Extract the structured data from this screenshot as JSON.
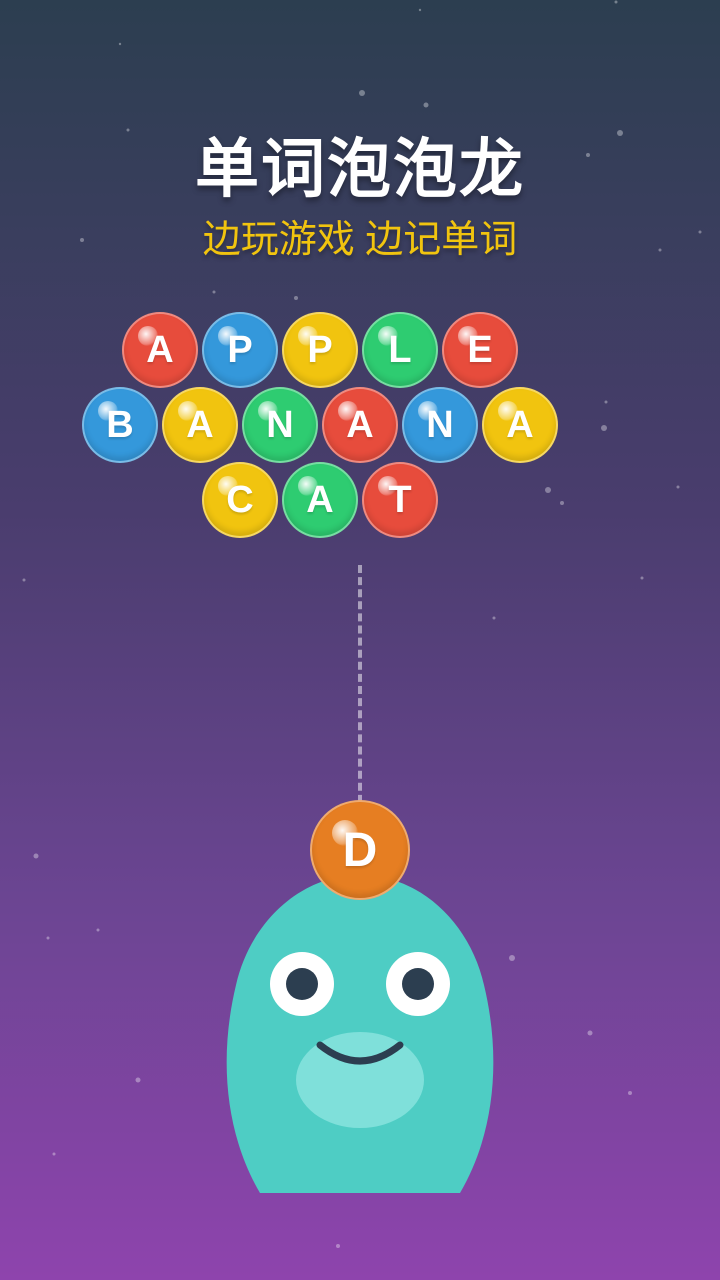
{
  "header": {
    "title": "单词泡泡龙",
    "subtitle": "边玩游戏 边记单词"
  },
  "colors": {
    "red": "#e74c3c",
    "blue": "#3498db",
    "yellow": "#f1c40f",
    "green": "#2ecc71",
    "orange": "#e67e22",
    "monster": "#4ecdc4",
    "title": "#ffffff",
    "subtitle": "#f1c40f"
  },
  "board": {
    "rows": [
      {
        "word": "APPLE",
        "bubbles": [
          {
            "letter": "A",
            "color": "red"
          },
          {
            "letter": "P",
            "color": "blue"
          },
          {
            "letter": "P",
            "color": "yellow"
          },
          {
            "letter": "L",
            "color": "green"
          },
          {
            "letter": "E",
            "color": "red"
          }
        ]
      },
      {
        "word": "BANANA",
        "bubbles": [
          {
            "letter": "B",
            "color": "blue"
          },
          {
            "letter": "A",
            "color": "yellow"
          },
          {
            "letter": "N",
            "color": "green"
          },
          {
            "letter": "A",
            "color": "red"
          },
          {
            "letter": "N",
            "color": "blue"
          },
          {
            "letter": "A",
            "color": "yellow"
          }
        ]
      },
      {
        "word": "CAT",
        "bubbles": [
          {
            "letter": "C",
            "color": "yellow"
          },
          {
            "letter": "A",
            "color": "green"
          },
          {
            "letter": "T",
            "color": "red"
          }
        ]
      }
    ]
  },
  "shooter": {
    "letter": "D",
    "color": "orange"
  },
  "monster_icon": "green-blob-monster-icon"
}
